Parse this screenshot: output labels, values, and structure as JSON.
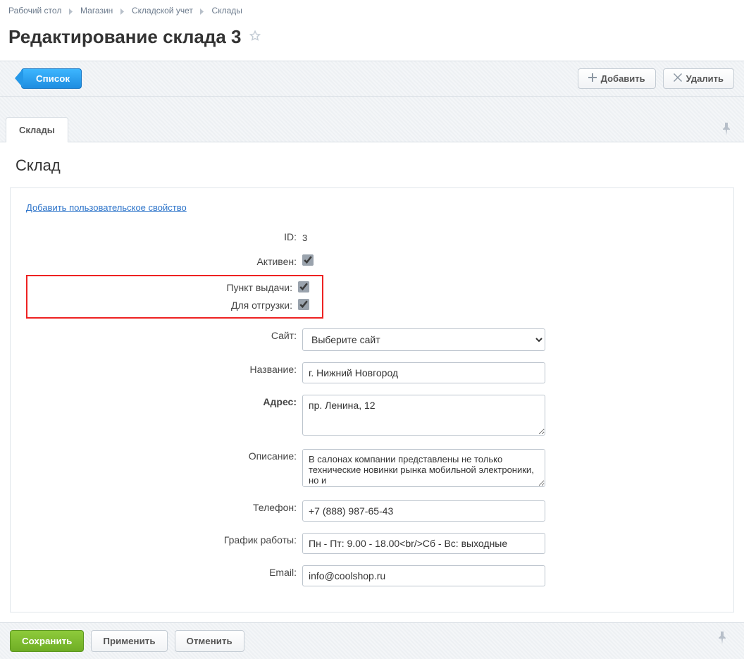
{
  "breadcrumbs": {
    "items": [
      {
        "label": "Рабочий стол"
      },
      {
        "label": "Магазин"
      },
      {
        "label": "Складской учет"
      },
      {
        "label": "Склады"
      }
    ]
  },
  "page_title": "Редактирование склада 3",
  "toolbar": {
    "list_label": "Список",
    "add_label": "Добавить",
    "delete_label": "Удалить"
  },
  "tab": {
    "label": "Склады"
  },
  "section": {
    "heading": "Склад",
    "add_property_link": "Добавить пользовательское свойство"
  },
  "form": {
    "id_label": "ID:",
    "id_value": "3",
    "active_label": "Активен:",
    "active_checked": true,
    "pickup_label": "Пункт выдачи:",
    "pickup_checked": true,
    "shipping_label": "Для отгрузки:",
    "shipping_checked": true,
    "site_label": "Сайт:",
    "site_placeholder": "Выберите сайт",
    "name_label": "Название:",
    "name_value": "г. Нижний Новгород",
    "address_label": "Адрес:",
    "address_value": "пр. Ленина, 12",
    "description_label": "Описание:",
    "description_value": "В салонах компании представлены не только технические новинки рынка мобильной электроники, но и",
    "phone_label": "Телефон:",
    "phone_value": "+7 (888) 987-65-43",
    "schedule_label": "График работы:",
    "schedule_value": "Пн - Пт: 9.00 - 18.00<br/>Сб - Вс: выходные",
    "email_label": "Email:",
    "email_value": "info@coolshop.ru"
  },
  "footer": {
    "save_label": "Сохранить",
    "apply_label": "Применить",
    "cancel_label": "Отменить"
  }
}
